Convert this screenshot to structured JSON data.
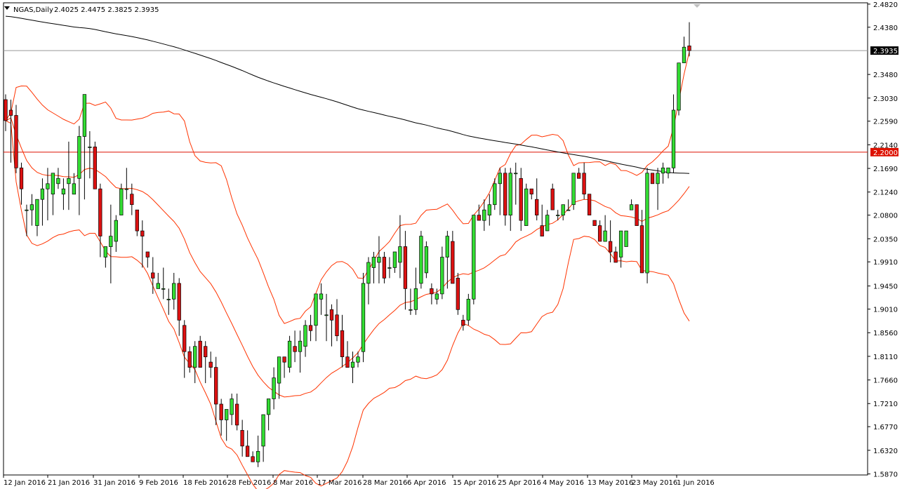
{
  "header": {
    "title": "NGAS,Daily",
    "ohlc": "2.4025 2.4475 2.3825 2.3935"
  },
  "colors": {
    "background": "#ffffff",
    "bull_fill": "#33dd33",
    "bear_fill": "#dd1111",
    "candle_outline": "#000000",
    "bollinger": "#ff3300",
    "moving_average": "#000000",
    "price_line": "#999999",
    "level_line": "#dd1100",
    "price_tag_bg": "#000000",
    "level_tag_bg": "#dd1100"
  },
  "chart_data": {
    "type": "candlestick",
    "symbol": "NGAS",
    "timeframe": "Daily",
    "ylim": [
      1.585,
      2.4845
    ],
    "yticks": [
      "2.4820",
      "2.4380",
      "2.3935",
      "2.3480",
      "2.3030",
      "2.2590",
      "2.2140",
      "2.2000",
      "2.1690",
      "2.1240",
      "2.0800",
      "2.0350",
      "1.9910",
      "1.9450",
      "1.9010",
      "1.8560",
      "1.8110",
      "1.7660",
      "1.7210",
      "1.6770",
      "1.6320",
      "1.5870"
    ],
    "xlabels": [
      "12 Jan 2016",
      "21 Jan 2016",
      "31 Jan 2016",
      "9 Feb 2016",
      "18 Feb 2016",
      "28 Feb 2016",
      "8 Mar 2016",
      "17 Mar 2016",
      "28 Mar 2016",
      "6 Apr 2016",
      "15 Apr 2016",
      "25 Apr 2016",
      "4 May 2016",
      "13 May 2016",
      "23 May 2016",
      "1 Jun 2016"
    ],
    "current_price": "2.3935",
    "horizontal_level": "2.2000",
    "candles": [
      [
        2.3,
        2.31,
        2.24,
        2.26
      ],
      [
        2.28,
        2.3,
        2.18,
        2.27
      ],
      [
        2.27,
        2.29,
        2.16,
        2.17
      ],
      [
        2.17,
        2.18,
        2.1,
        2.13
      ],
      [
        2.09,
        2.1,
        2.04,
        2.09
      ],
      [
        2.09,
        2.12,
        2.06,
        2.1
      ],
      [
        2.06,
        2.11,
        2.04,
        2.11
      ],
      [
        2.11,
        2.15,
        2.06,
        2.13
      ],
      [
        2.13,
        2.17,
        2.07,
        2.14
      ],
      [
        2.12,
        2.15,
        2.08,
        2.16
      ],
      [
        2.14,
        2.17,
        2.13,
        2.15
      ],
      [
        2.12,
        2.15,
        2.09,
        2.13
      ],
      [
        2.14,
        2.22,
        2.09,
        2.15
      ],
      [
        2.12,
        2.16,
        2.12,
        2.14
      ],
      [
        2.15,
        2.25,
        2.08,
        2.23
      ],
      [
        2.23,
        2.3,
        2.11,
        2.31
      ],
      [
        2.21,
        2.24,
        2.15,
        2.21
      ],
      [
        2.21,
        2.22,
        2.13,
        2.13
      ],
      [
        2.13,
        2.14,
        2.0,
        2.04
      ],
      [
        2.0,
        2.0,
        1.98,
        2.02
      ],
      [
        2.02,
        2.1,
        1.95,
        2.04
      ],
      [
        2.03,
        2.08,
        2.01,
        2.07
      ],
      [
        2.08,
        2.14,
        2.08,
        2.13
      ],
      [
        2.13,
        2.17,
        2.11,
        2.13
      ],
      [
        2.12,
        2.14,
        2.08,
        2.1
      ],
      [
        2.09,
        2.09,
        2.04,
        2.05
      ],
      [
        2.05,
        2.07,
        1.98,
        2.04
      ],
      [
        2.01,
        2.01,
        1.98,
        2.0
      ],
      [
        1.97,
        2.0,
        1.93,
        1.96
      ],
      [
        1.94,
        1.97,
        1.94,
        1.95
      ],
      [
        1.94,
        1.98,
        1.92,
        1.94
      ],
      [
        1.92,
        1.94,
        1.89,
        1.92
      ],
      [
        1.92,
        1.97,
        1.9,
        1.95
      ],
      [
        1.95,
        1.96,
        1.85,
        1.88
      ],
      [
        1.87,
        1.88,
        1.77,
        1.82
      ],
      [
        1.82,
        1.83,
        1.78,
        1.79
      ],
      [
        1.79,
        1.84,
        1.76,
        1.83
      ],
      [
        1.84,
        1.85,
        1.79,
        1.79
      ],
      [
        1.83,
        1.84,
        1.76,
        1.81
      ],
      [
        1.8,
        1.82,
        1.77,
        1.79
      ],
      [
        1.79,
        1.81,
        1.68,
        1.72
      ],
      [
        1.72,
        1.73,
        1.66,
        1.69
      ],
      [
        1.69,
        1.71,
        1.65,
        1.71
      ],
      [
        1.7,
        1.74,
        1.68,
        1.73
      ],
      [
        1.72,
        1.74,
        1.67,
        1.68
      ],
      [
        1.67,
        1.69,
        1.62,
        1.64
      ],
      [
        1.64,
        1.67,
        1.62,
        1.62
      ],
      [
        1.62,
        1.63,
        1.61,
        1.61
      ],
      [
        1.61,
        1.66,
        1.6,
        1.63
      ],
      [
        1.64,
        1.69,
        1.61,
        1.7
      ],
      [
        1.7,
        1.73,
        1.67,
        1.73
      ],
      [
        1.73,
        1.79,
        1.71,
        1.77
      ],
      [
        1.76,
        1.8,
        1.73,
        1.81
      ],
      [
        1.81,
        1.81,
        1.77,
        1.8
      ],
      [
        1.79,
        1.85,
        1.78,
        1.84
      ],
      [
        1.83,
        1.86,
        1.8,
        1.82
      ],
      [
        1.82,
        1.86,
        1.78,
        1.84
      ],
      [
        1.83,
        1.88,
        1.81,
        1.87
      ],
      [
        1.87,
        1.89,
        1.84,
        1.86
      ],
      [
        1.87,
        1.92,
        1.84,
        1.93
      ],
      [
        1.92,
        1.95,
        1.89,
        1.93
      ],
      [
        1.89,
        1.93,
        1.84,
        1.89
      ],
      [
        1.9,
        1.91,
        1.83,
        1.88
      ],
      [
        1.89,
        1.92,
        1.84,
        1.85
      ],
      [
        1.86,
        1.89,
        1.79,
        1.81
      ],
      [
        1.81,
        1.84,
        1.79,
        1.79
      ],
      [
        1.79,
        1.82,
        1.76,
        1.8
      ],
      [
        1.8,
        1.82,
        1.79,
        1.81
      ],
      [
        1.82,
        1.97,
        1.8,
        1.95
      ],
      [
        1.95,
        2.0,
        1.91,
        1.99
      ],
      [
        1.98,
        2.01,
        1.95,
        2.0
      ],
      [
        1.99,
        2.04,
        1.95,
        2.0
      ],
      [
        2.0,
        2.01,
        1.95,
        1.96
      ],
      [
        1.98,
        2.0,
        1.96,
        1.98
      ],
      [
        1.98,
        2.01,
        1.97,
        2.01
      ],
      [
        1.99,
        2.08,
        1.96,
        2.02
      ],
      [
        2.02,
        2.05,
        1.9,
        1.94
      ],
      [
        1.9,
        1.94,
        1.89,
        1.9
      ],
      [
        1.9,
        1.98,
        1.89,
        1.94
      ],
      [
        1.95,
        2.05,
        1.94,
        2.04
      ],
      [
        1.97,
        2.03,
        1.96,
        2.02
      ],
      [
        1.94,
        1.95,
        1.91,
        1.93
      ],
      [
        1.92,
        1.94,
        1.91,
        1.93
      ],
      [
        1.93,
        2.02,
        1.92,
        2.0
      ],
      [
        2.0,
        2.05,
        1.94,
        2.04
      ],
      [
        2.03,
        2.05,
        1.95,
        1.95
      ],
      [
        1.96,
        1.97,
        1.89,
        1.9
      ],
      [
        1.88,
        1.89,
        1.86,
        1.87
      ],
      [
        1.88,
        1.93,
        1.87,
        1.92
      ],
      [
        1.92,
        2.08,
        1.91,
        2.08
      ],
      [
        2.08,
        2.1,
        2.07,
        2.07
      ],
      [
        2.07,
        2.11,
        2.05,
        2.09
      ],
      [
        2.08,
        2.12,
        2.06,
        2.1
      ],
      [
        2.1,
        2.15,
        2.09,
        2.14
      ],
      [
        2.14,
        2.17,
        2.08,
        2.16
      ],
      [
        2.16,
        2.17,
        2.06,
        2.08
      ],
      [
        2.08,
        2.17,
        2.05,
        2.16
      ],
      [
        2.16,
        2.18,
        2.1,
        2.16
      ],
      [
        2.15,
        2.17,
        2.05,
        2.07
      ],
      [
        2.06,
        2.14,
        2.06,
        2.13
      ],
      [
        2.13,
        2.13,
        2.11,
        2.12
      ],
      [
        2.11,
        2.15,
        2.07,
        2.08
      ],
      [
        2.06,
        2.1,
        2.04,
        2.04
      ],
      [
        2.05,
        2.09,
        2.05,
        2.08
      ],
      [
        2.13,
        2.14,
        2.09,
        2.09
      ],
      [
        2.08,
        2.09,
        2.07,
        2.08
      ],
      [
        2.08,
        2.1,
        2.07,
        2.1
      ],
      [
        2.09,
        2.11,
        2.09,
        2.09
      ],
      [
        2.1,
        2.15,
        2.09,
        2.16
      ],
      [
        2.16,
        2.17,
        2.15,
        2.15
      ],
      [
        2.16,
        2.18,
        2.11,
        2.12
      ],
      [
        2.12,
        2.12,
        2.08,
        2.08
      ],
      [
        2.07,
        2.07,
        2.06,
        2.06
      ],
      [
        2.06,
        2.07,
        2.03,
        2.03
      ],
      [
        2.03,
        2.08,
        2.03,
        2.05
      ],
      [
        2.03,
        2.07,
        1.99,
        2.01
      ],
      [
        2.01,
        2.02,
        1.99,
        1.99
      ],
      [
        2.0,
        2.05,
        1.98,
        2.05
      ],
      [
        2.02,
        2.05,
        2.02,
        2.05
      ],
      [
        2.09,
        2.11,
        2.1,
        2.1
      ],
      [
        2.1,
        2.1,
        2.08,
        2.06
      ],
      [
        2.06,
        2.09,
        1.98,
        1.97
      ],
      [
        1.97,
        2.17,
        1.95,
        2.16
      ],
      [
        2.16,
        2.16,
        2.14,
        2.14
      ],
      [
        2.14,
        2.17,
        2.09,
        2.16
      ],
      [
        2.16,
        2.18,
        2.14,
        2.17
      ],
      [
        2.16,
        2.17,
        2.15,
        2.17
      ],
      [
        2.17,
        2.31,
        2.16,
        2.28
      ],
      [
        2.28,
        2.34,
        2.27,
        2.37
      ],
      [
        2.37,
        2.42,
        2.37,
        2.4
      ],
      [
        2.4025,
        2.4475,
        2.3825,
        2.3935
      ]
    ]
  }
}
